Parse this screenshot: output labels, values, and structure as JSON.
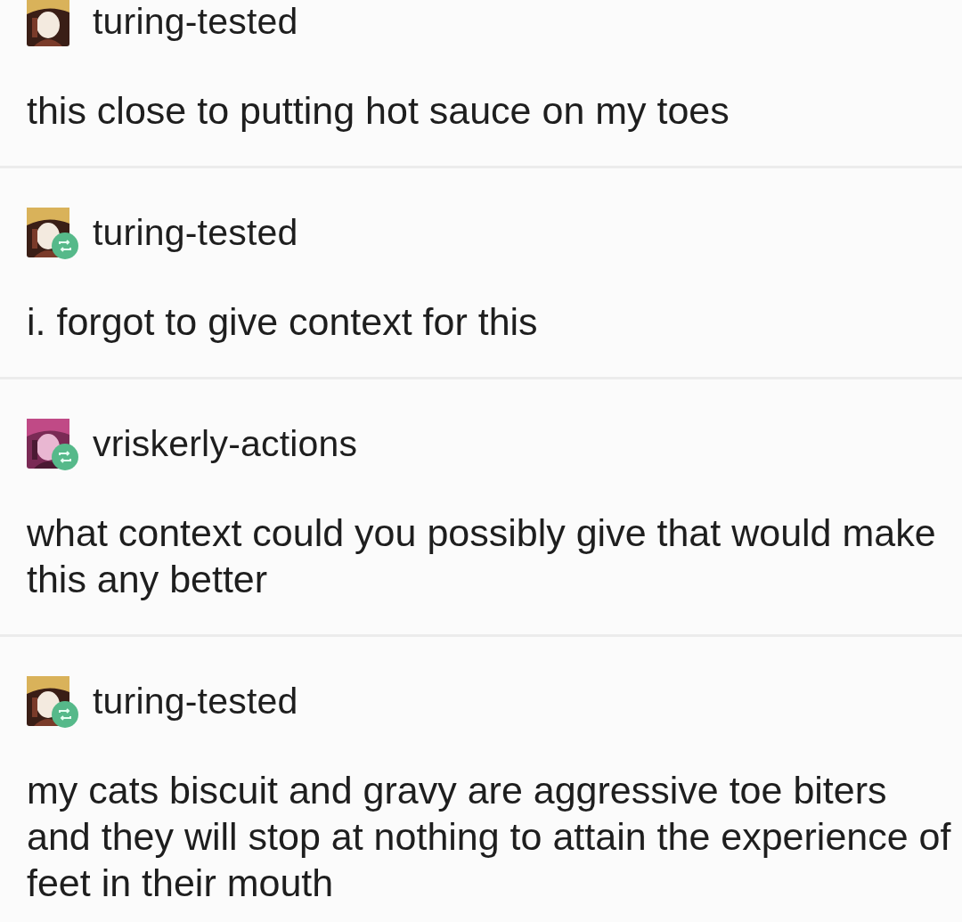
{
  "posts": [
    {
      "username": "turing-tested",
      "reblogged": false,
      "text": "this close to putting hot sauce on my toes"
    },
    {
      "username": "turing-tested",
      "reblogged": true,
      "text": "i. forgot to give context for this"
    },
    {
      "username": "vriskerly-actions",
      "reblogged": true,
      "text": "what context could you possibly give that would make this any better"
    },
    {
      "username": "turing-tested",
      "reblogged": true,
      "text": "my cats biscuit and gravy are aggressive toe biters and they will stop at nothing to attain the experience of feet in their mouth"
    }
  ]
}
